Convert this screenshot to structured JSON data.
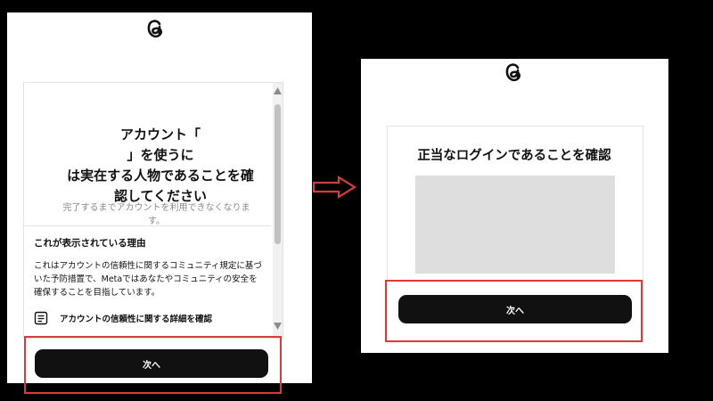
{
  "left_dialog": {
    "title_line1_before": "アカウント「",
    "title_line1_after": "」を使うに",
    "title_line2": "は実在する人物であることを確",
    "title_line3": "認してください",
    "subtitle_line1": "完了するまでアカウントを利用できなくなりま",
    "subtitle_line2": "す。",
    "reason_heading": "これが表示されている理由",
    "reason_line1": "これはアカウントの信頼性に関するコミュニティ規定に基づ",
    "reason_line2": "いた予防措置で、Metaではあなたやコミュニティの安全を",
    "reason_line3": "確保することを目指しています。",
    "details_link": "アカウントの信頼性に関する詳細を確認",
    "next_button": "次へ"
  },
  "right_dialog": {
    "title": "正当なログインであることを確認",
    "next_button": "次へ"
  },
  "icons": {
    "logo": "threads-logo-icon",
    "details": "document-icon",
    "flow": "arrow-right-icon"
  },
  "colors": {
    "highlight": "#d93a3a",
    "button": "#111111",
    "captcha_placeholder": "#dedede"
  }
}
